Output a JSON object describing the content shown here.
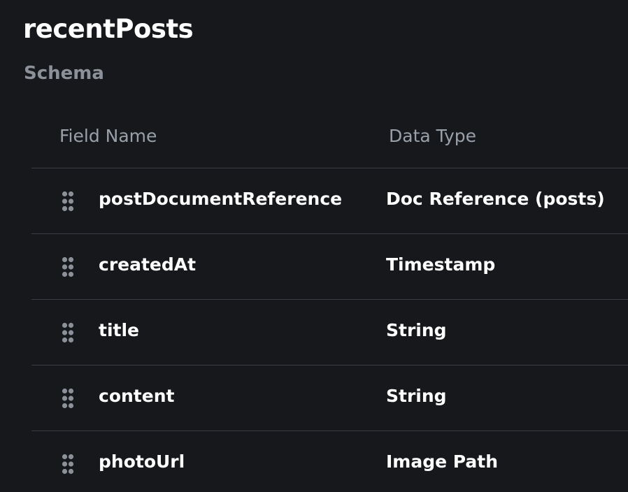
{
  "collection": {
    "title": "recentPosts",
    "subtitle": "Schema"
  },
  "table": {
    "headers": {
      "field_name": "Field Name",
      "data_type": "Data Type"
    },
    "rows": [
      {
        "name": "postDocumentReference",
        "type": "Doc Reference (posts)",
        "handle_icon": "drag-handle-icon"
      },
      {
        "name": "createdAt",
        "type": "Timestamp",
        "handle_icon": "drag-handle-icon"
      },
      {
        "name": "title",
        "type": "String",
        "handle_icon": "drag-handle-icon"
      },
      {
        "name": "content",
        "type": "String",
        "handle_icon": "drag-handle-icon"
      },
      {
        "name": "photoUrl",
        "type": "Image Path",
        "handle_icon": "drag-handle-icon"
      }
    ]
  },
  "colors": {
    "background": "#16181c",
    "text": "#ffffff",
    "muted": "#8b9099",
    "divider": "#3a3d44"
  }
}
